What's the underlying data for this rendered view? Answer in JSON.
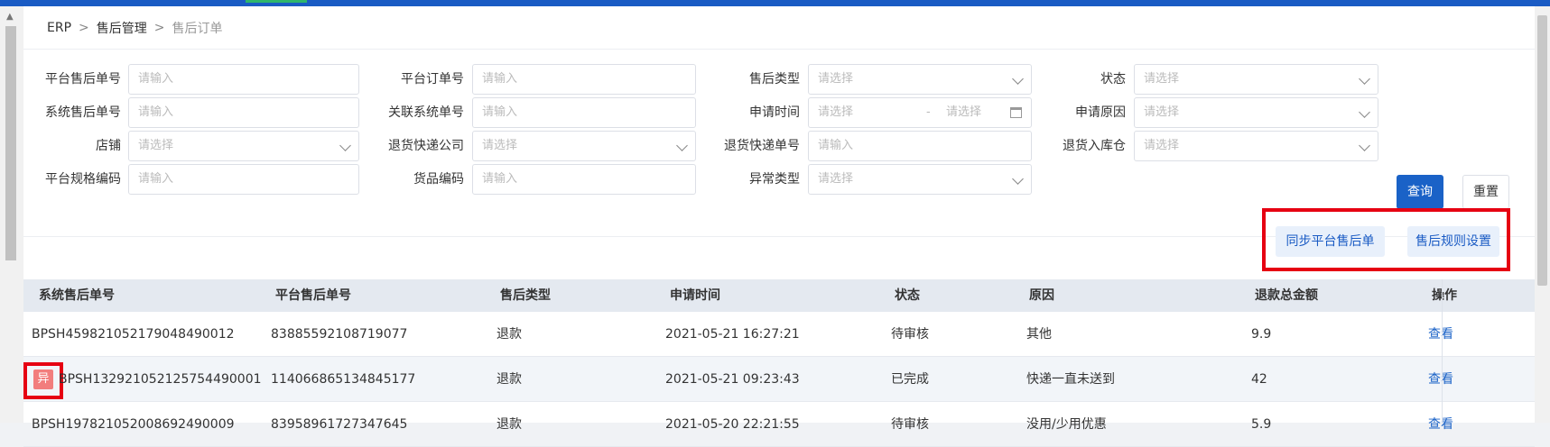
{
  "breadcrumb": [
    "ERP",
    "售后管理",
    "售后订单"
  ],
  "filters": {
    "platform_after_sale_no": {
      "label": "平台售后单号",
      "placeholder": "请输入"
    },
    "platform_order_no": {
      "label": "平台订单号",
      "placeholder": "请输入"
    },
    "after_sale_type": {
      "label": "售后类型",
      "placeholder": "请选择"
    },
    "status": {
      "label": "状态",
      "placeholder": "请选择"
    },
    "system_after_sale_no": {
      "label": "系统售后单号",
      "placeholder": "请输入"
    },
    "related_system_no": {
      "label": "关联系统单号",
      "placeholder": "请输入"
    },
    "apply_time": {
      "label": "申请时间",
      "start_placeholder": "请选择",
      "separator": "-",
      "end_placeholder": "请选择"
    },
    "apply_reason": {
      "label": "申请原因",
      "placeholder": "请选择"
    },
    "shop": {
      "label": "店铺",
      "placeholder": "请选择"
    },
    "return_express_company": {
      "label": "退货快递公司",
      "placeholder": "请选择"
    },
    "return_express_no": {
      "label": "退货快递单号",
      "placeholder": "请输入"
    },
    "return_warehouse": {
      "label": "退货入库仓",
      "placeholder": "请选择"
    },
    "platform_sku_code": {
      "label": "平台规格编码",
      "placeholder": "请输入"
    },
    "goods_code": {
      "label": "货品编码",
      "placeholder": "请输入"
    },
    "exception_type": {
      "label": "异常类型",
      "placeholder": "请选择"
    }
  },
  "buttons": {
    "query": "查询",
    "reset": "重置",
    "sync": "同步平台售后单",
    "rules": "售后规则设置"
  },
  "table": {
    "headers": [
      "系统售后单号",
      "平台售后单号",
      "售后类型",
      "申请时间",
      "状态",
      "原因",
      "退款总金额",
      "操作"
    ],
    "rows": [
      {
        "sys_no": "BPSH459821052179048490012",
        "plat_no": "83885592108719077",
        "type": "退款",
        "time": "2021-05-21 16:27:21",
        "status": "待审核",
        "reason": "其他",
        "amount": "9.9",
        "action": "查看"
      },
      {
        "badge": "异",
        "sys_no": "BPSH132921052125754490001",
        "plat_no": "114066865134845177",
        "type": "退款",
        "time": "2021-05-21 09:23:43",
        "status": "已完成",
        "reason": "快递一直未送到",
        "amount": "42",
        "action": "查看"
      },
      {
        "sys_no": "BPSH197821052008692490009",
        "plat_no": "83958961727347645",
        "type": "退款",
        "time": "2021-05-20 22:21:55",
        "status": "待审核",
        "reason": "没用/少用优惠",
        "amount": "5.9",
        "action": "查看"
      }
    ]
  },
  "colors": {
    "primary": "#1a62c7",
    "highlight_box": "#e60012",
    "badge": "#f27d7d"
  }
}
